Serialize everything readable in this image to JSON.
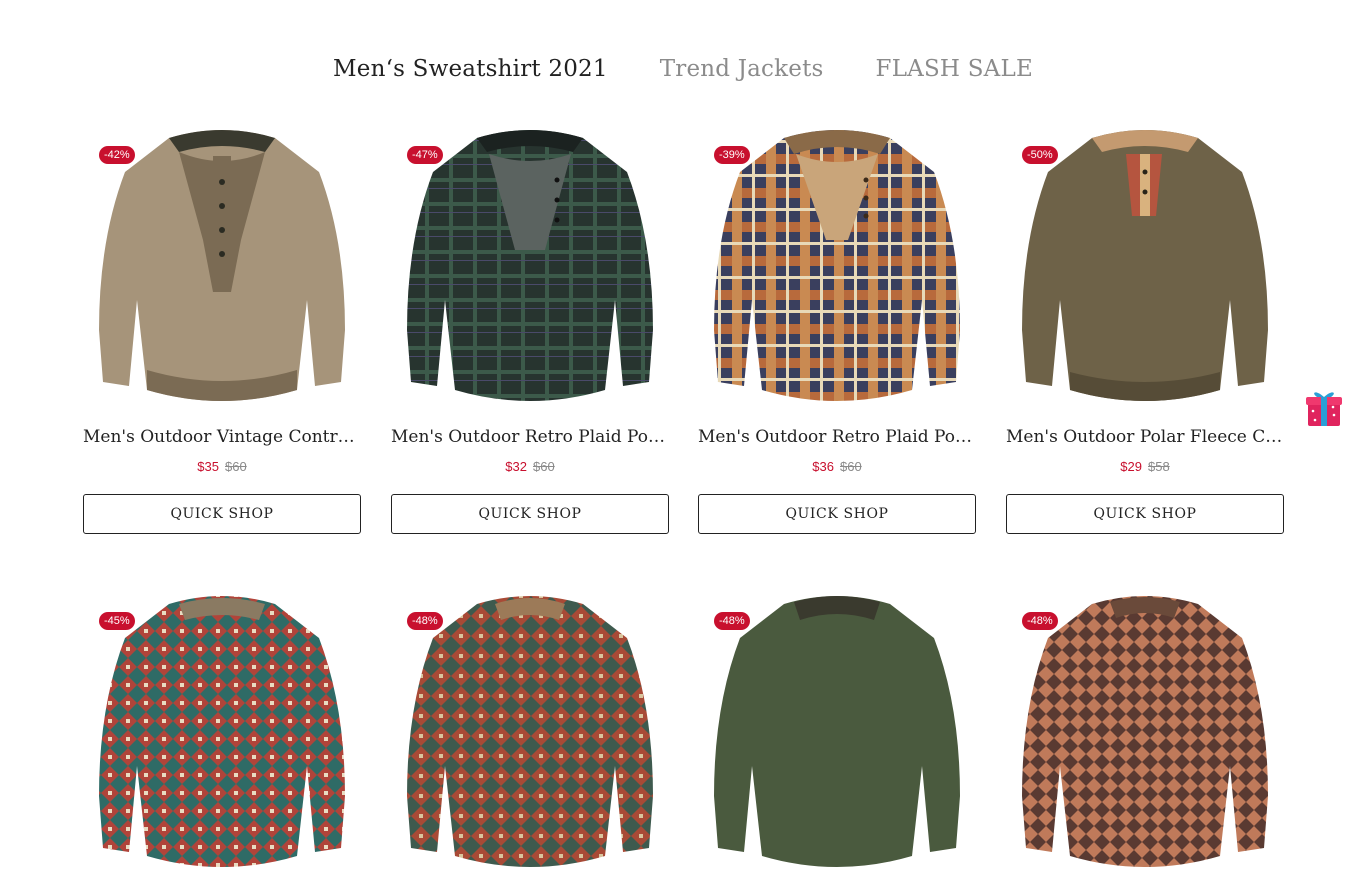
{
  "tabs": [
    {
      "label": "Men‘s Sweatshirt 2021",
      "active": true
    },
    {
      "label": "Trend Jackets",
      "active": false
    },
    {
      "label": "FLASH SALE",
      "active": false
    }
  ],
  "products": [
    {
      "badge": "-42%",
      "title": "Men's Outdoor Vintage Contras...",
      "price": "$35",
      "old_price": "$60",
      "button": "QUICK SHOP",
      "colors": {
        "body": "#a6947a",
        "dark": "#7b6b54",
        "placket": "#3a3a2f"
      }
    },
    {
      "badge": "-47%",
      "title": "Men's Outdoor Retro Plaid Pola...",
      "price": "$32",
      "old_price": "$60",
      "button": "QUICK SHOP",
      "colors": {
        "body": "#27342f",
        "dark": "#1b2220",
        "placket": "#5b6360"
      }
    },
    {
      "badge": "-39%",
      "title": "Men's Outdoor Retro Plaid Pola...",
      "price": "$36",
      "old_price": "$60",
      "button": "QUICK SHOP",
      "colors": {
        "body": "#3a3f5e",
        "dark": "#b86a3c",
        "placket": "#8a6a48"
      }
    },
    {
      "badge": "-50%",
      "title": "Men's Outdoor Polar Fleece Co...",
      "price": "$29",
      "old_price": "$58",
      "button": "QUICK SHOP",
      "colors": {
        "body": "#6e6248",
        "dark": "#564c37",
        "placket": "#c49a70"
      }
    },
    {
      "badge": "-45%"
    },
    {
      "badge": "-48%"
    },
    {
      "badge": "-48%"
    },
    {
      "badge": "-48%"
    }
  ],
  "gift_icon": "gift-icon",
  "accent_color": "#c8102e"
}
